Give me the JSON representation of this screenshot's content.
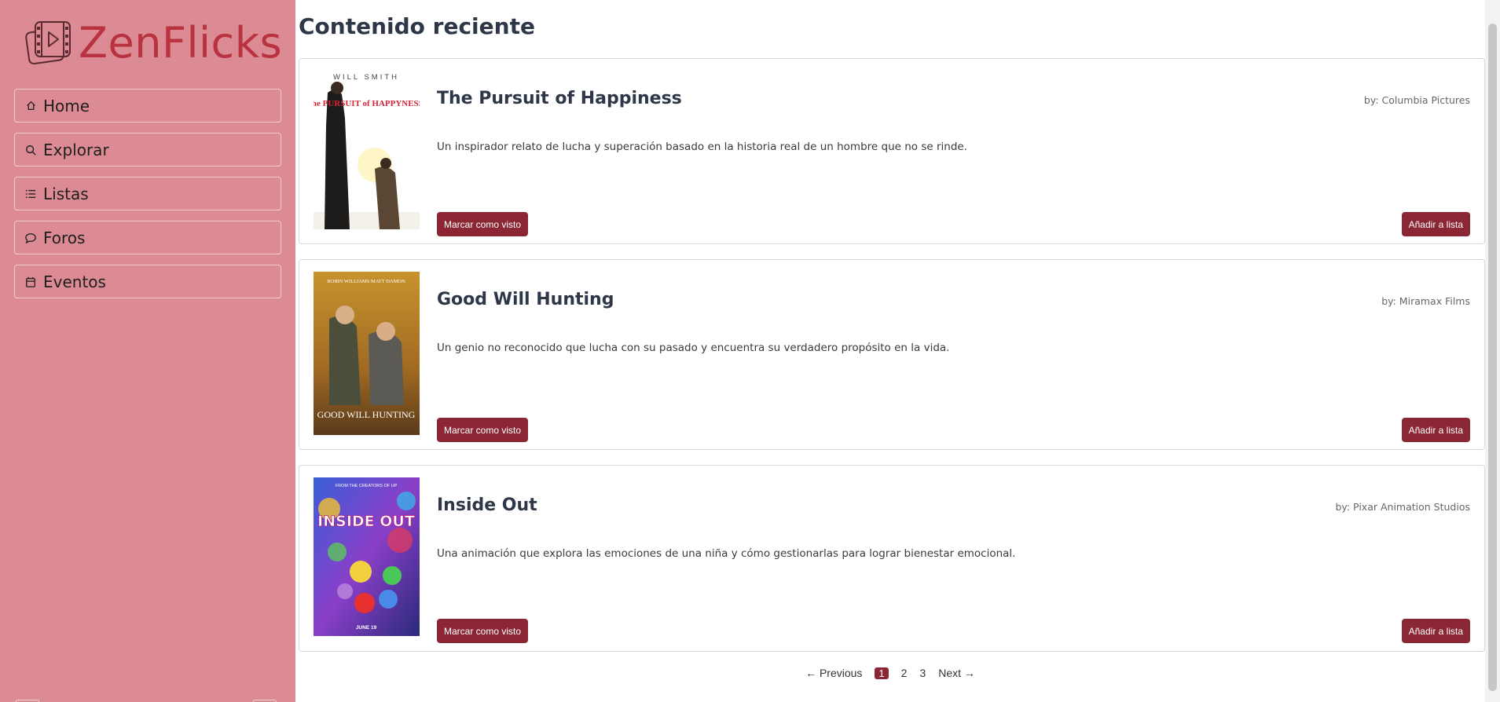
{
  "sidebar": {
    "logo_text": "ZenFlicks",
    "items": [
      {
        "label": "Home",
        "icon": "home-icon"
      },
      {
        "label": "Explorar",
        "icon": "search-icon"
      },
      {
        "label": "Listas",
        "icon": "list-icon"
      },
      {
        "label": "Foros",
        "icon": "chat-icon"
      },
      {
        "label": "Eventos",
        "icon": "calendar-icon"
      }
    ]
  },
  "main": {
    "title": "Contenido reciente",
    "cards": [
      {
        "title": "The Pursuit of Happiness",
        "by": "by: Columbia Pictures",
        "description": "Un inspirador relato de lucha y superación basado en la historia real de un hombre que no se rinde.",
        "poster_text": "the PURSUIT of HAPPYNESS",
        "poster_top": "WILL SMITH",
        "seen_label": "Marcar como visto",
        "add_label": "Añadir a lista"
      },
      {
        "title": "Good Will Hunting",
        "by": "by: Miramax Films",
        "description": "Un genio no reconocido que lucha con su pasado y encuentra su verdadero propósito en la vida.",
        "poster_text": "GOOD WILL HUNTING",
        "poster_top": "ROBIN WILLIAMS MATT DAMON",
        "seen_label": "Marcar como visto",
        "add_label": "Añadir a lista"
      },
      {
        "title": "Inside Out",
        "by": "by: Pixar Animation Studios",
        "description": "Una animación que explora las emociones de una niña y cómo gestionarlas para lograr bienestar emocional.",
        "poster_text": "INSIDE OUT",
        "poster_top": "FROM THE CREATORS OF UP",
        "poster_bottom": "JUNE 19",
        "seen_label": "Marcar como visto",
        "add_label": "Añadir a lista"
      }
    ],
    "pagination": {
      "previous": "← Previous",
      "pages": [
        "1",
        "2",
        "3"
      ],
      "active": "1",
      "next": "Next →"
    }
  },
  "colors": {
    "sidebar_bg": "#dc8a94",
    "logo": "#b8323f",
    "accent": "#8b2634"
  }
}
